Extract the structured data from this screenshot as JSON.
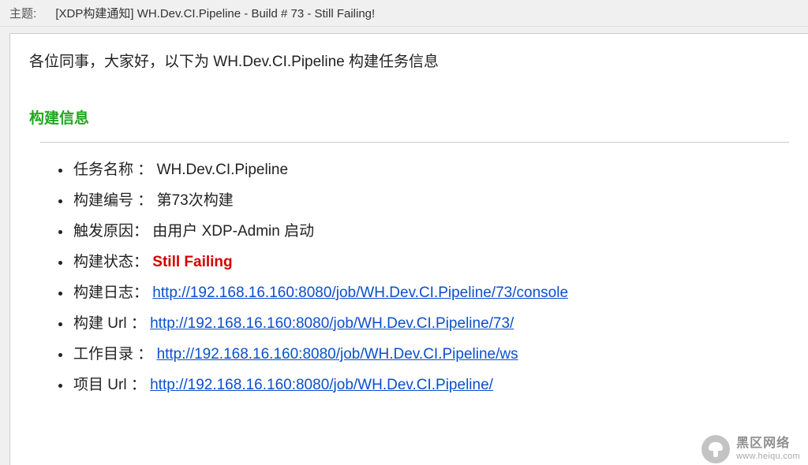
{
  "header": {
    "label": "主题:",
    "subject": "[XDP构建通知] WH.Dev.CI.Pipeline - Build # 73 - Still Failing!"
  },
  "body": {
    "greeting": "各位同事，大家好，以下为 WH.Dev.CI.Pipeline 构建任务信息",
    "section_title": "构建信息",
    "items": [
      {
        "label": "任务名称 ：",
        "value": " WH.Dev.CI.Pipeline",
        "is_link": false,
        "is_status": false
      },
      {
        "label": "构建编号 ：",
        "value": " 第73次构建",
        "is_link": false,
        "is_status": false
      },
      {
        "label": "触发原因：",
        "value": " 由用户 XDP-Admin 启动",
        "is_link": false,
        "is_status": false
      },
      {
        "label": "构建状态：",
        "value": " Still Failing",
        "is_link": false,
        "is_status": true
      },
      {
        "label": "构建日志：",
        "value": " http://192.168.16.160:8080/job/WH.Dev.CI.Pipeline/73/console",
        "is_link": true,
        "is_status": false
      },
      {
        "label": "构建 Url ：",
        "value": " http://192.168.16.160:8080/job/WH.Dev.CI.Pipeline/73/",
        "is_link": true,
        "is_status": false
      },
      {
        "label": "工作目录 ：",
        "value": " http://192.168.16.160:8080/job/WH.Dev.CI.Pipeline/ws",
        "is_link": true,
        "is_status": false
      },
      {
        "label": "项目 Url ：",
        "value": " http://192.168.16.160:8080/job/WH.Dev.CI.Pipeline/",
        "is_link": true,
        "is_status": false
      }
    ]
  },
  "watermark": {
    "cn": "黑区网络",
    "url": "www.heiqu.com"
  }
}
